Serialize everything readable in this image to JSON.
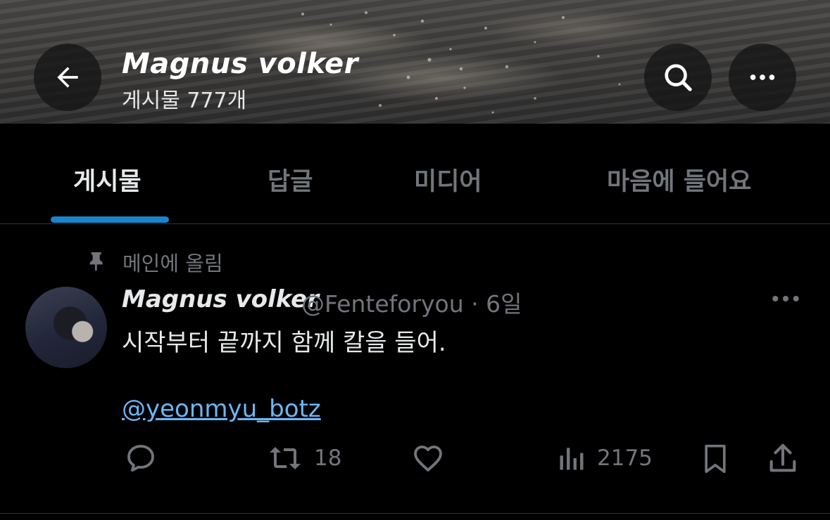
{
  "header": {
    "name": "Magnus volker",
    "post_count": "게시물 777개",
    "back_icon": "back-arrow-icon",
    "search_icon": "search-icon",
    "more_icon": "more-horizontal-icon"
  },
  "tabs": [
    {
      "label": "게시물",
      "active": true
    },
    {
      "label": "답글",
      "active": false
    },
    {
      "label": "미디어",
      "active": false
    },
    {
      "label": "마음에 들어요",
      "active": false
    }
  ],
  "pinned": {
    "label": "메인에 올림",
    "icon": "pin-icon"
  },
  "post": {
    "author": "Magnus volker",
    "meta": "@Fenteforyou · 6일",
    "text": "시작부터 끝까지 함께 칼을 들어.",
    "mention": "@yeonmyu_botz",
    "actions": {
      "reply": {
        "icon": "reply-icon",
        "count": ""
      },
      "repost": {
        "icon": "repost-icon",
        "count": "18"
      },
      "like": {
        "icon": "heart-icon",
        "count": ""
      },
      "views": {
        "icon": "views-icon",
        "count": "2175"
      },
      "bookmark": {
        "icon": "bookmark-icon"
      },
      "share": {
        "icon": "share-icon"
      }
    }
  },
  "colors": {
    "accent": "#1d9bf0",
    "mention": "#6cb6f5",
    "muted": "#71767b",
    "text": "#e7e9ea"
  }
}
